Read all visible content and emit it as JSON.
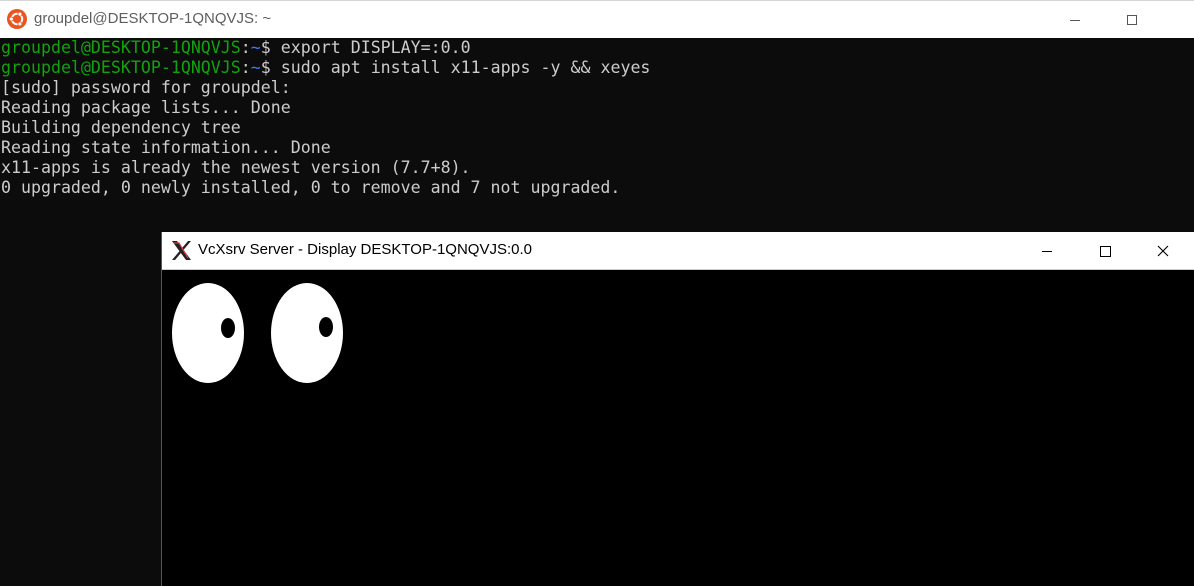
{
  "terminal_window": {
    "title": "groupdel@DESKTOP-1QNQVJS: ~",
    "app_icon": "ubuntu-icon",
    "controls": [
      "minimize-icon",
      "maximize-icon"
    ],
    "accent_color": "#e95420"
  },
  "terminal": {
    "prompt_user_host": "groupdel@DESKTOP-1QNQVJS",
    "prompt_sep": ":",
    "prompt_path": "~",
    "prompt_symbol": "$",
    "commands": [
      "export DISPLAY=:0.0",
      "sudo apt install x11-apps -y && xeyes"
    ],
    "output_lines": [
      "[sudo] password for groupdel:",
      "Reading package lists... Done",
      "Building dependency tree",
      "Reading state information... Done",
      "x11-apps is already the newest version (7.7+8).",
      "0 upgraded, 0 newly installed, 0 to remove and 7 not upgraded."
    ],
    "colors": {
      "background": "#0c0c0c",
      "prompt_user": "#13a10e",
      "prompt_path": "#3b78ff",
      "text": "#cccccc"
    }
  },
  "xserver_window": {
    "title": "VcXsrv Server - Display DESKTOP-1QNQVJS:0.0",
    "app_icon": "x-logo-icon",
    "controls": [
      "minimize-icon",
      "maximize-icon",
      "close-icon"
    ]
  },
  "xeyes": {
    "eye_color": "#ffffff",
    "pupil_color": "#000000"
  }
}
